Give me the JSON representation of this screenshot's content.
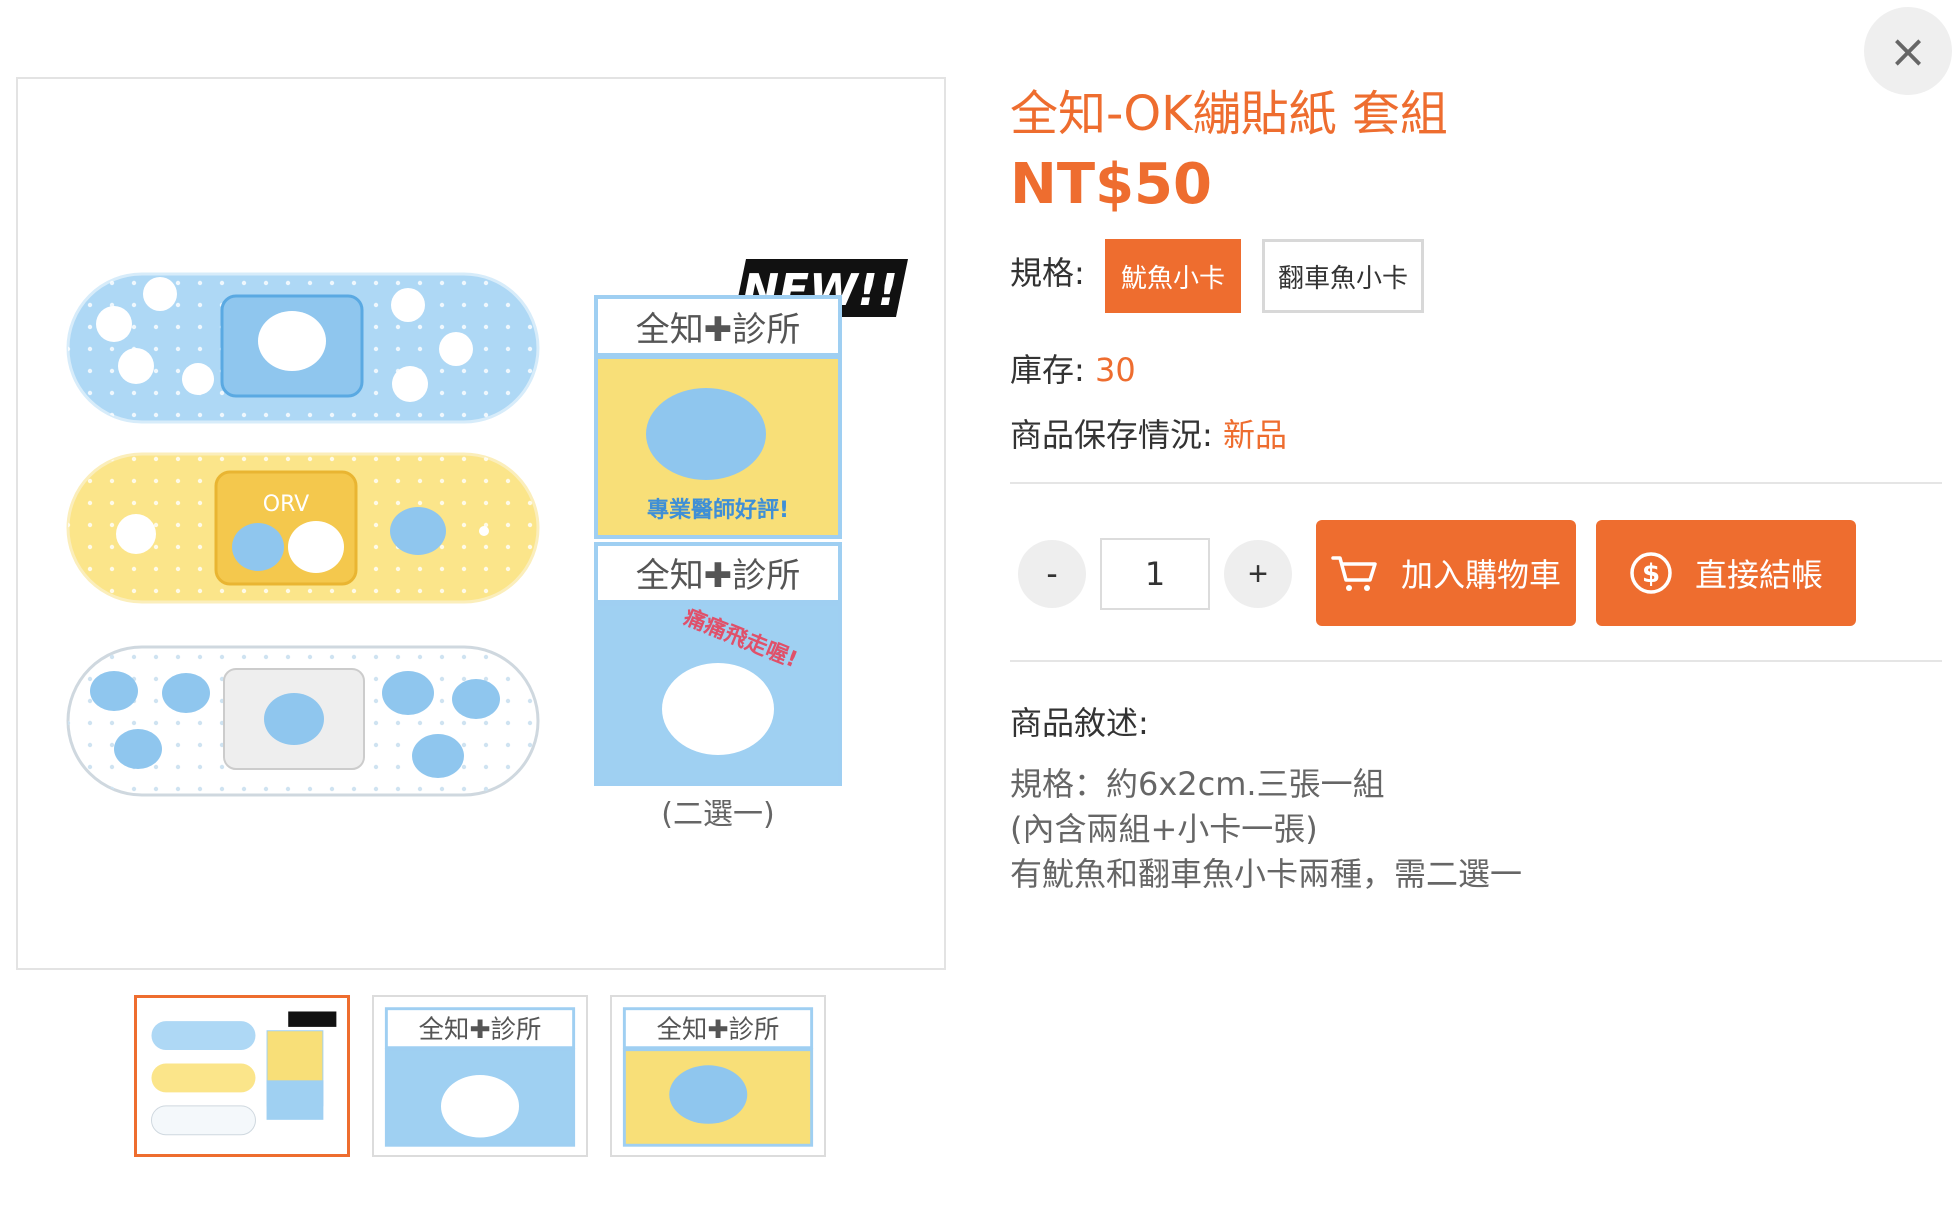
{
  "product": {
    "title": "全知-OK繃貼紙 套組",
    "price": "NT$50",
    "spec_label": "規格:",
    "spec_options": [
      "魷魚小卡",
      "翻車魚小卡"
    ],
    "stock_label": "庫存:",
    "stock_value": "30",
    "condition_label": "商品保存情況:",
    "condition_value": "新品"
  },
  "quantity": {
    "minus": "-",
    "value": "1",
    "plus": "+"
  },
  "actions": {
    "add_to_cart": "加入購物車",
    "checkout": "直接結帳"
  },
  "description": {
    "label": "商品敘述:",
    "lines": [
      "規格：約6x2cm.三張一組",
      "(內含兩組+小卡一張)",
      "有魷魚和翻車魚小卡兩種，需二選一"
    ]
  },
  "main_image": {
    "badge": "NEW!!",
    "clinic_title": "全知✚診所",
    "card1_caption": "專業醫師好評!",
    "card2_caption": "痛痛飛走喔!",
    "band_label": "ORV",
    "choice_note": "(二選一)"
  },
  "close_symbol": "×",
  "colors": {
    "accent": "#ee6d2f",
    "band_blue": "#aed8f5",
    "band_yellow": "#fbe58a",
    "card_yellow": "#f8df78",
    "card_blue": "#9fd0f2"
  }
}
